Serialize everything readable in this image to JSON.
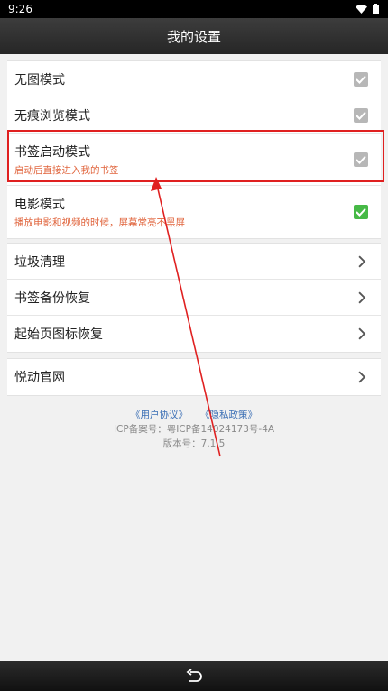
{
  "status": {
    "time": "9:26"
  },
  "title": "我的设置",
  "group1": [
    {
      "label": "无图模式",
      "checked": true
    },
    {
      "label": "无痕浏览模式",
      "checked": true
    },
    {
      "label": "书签启动模式",
      "sub": "启动后直接进入我的书签",
      "checked": true
    },
    {
      "label": "电影模式",
      "sub": "播放电影和视频的时候，屏幕常亮不黑屏",
      "checked": true
    }
  ],
  "group2": [
    {
      "label": "垃圾清理"
    },
    {
      "label": "书签备份恢复"
    },
    {
      "label": "起始页图标恢复"
    }
  ],
  "group3": [
    {
      "label": "悦动官网"
    }
  ],
  "footer": {
    "user_agreement": "《用户协议》",
    "privacy_policy": "《隐私政策》",
    "icp": "ICP备案号：粤ICP备14024173号-4A",
    "version": "版本号：7.1.5"
  },
  "colors": {
    "check_gray": "#b7b7b7",
    "check_green": "#46b946",
    "highlight_red": "#e02020",
    "subtitle_orange": "#e0643c",
    "link_blue": "#3b6fb5"
  }
}
